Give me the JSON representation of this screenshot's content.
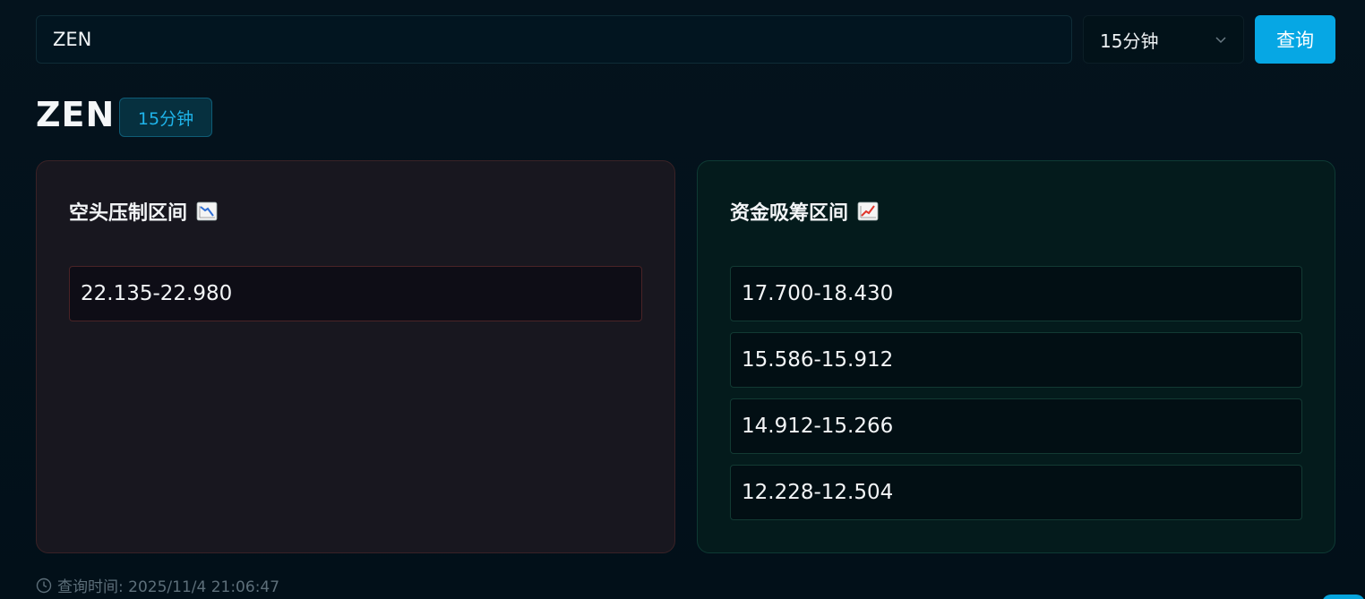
{
  "search": {
    "value": "ZEN"
  },
  "interval_select": {
    "selected": "15分钟",
    "icon": "chevron-down-icon"
  },
  "query_button": {
    "label": "查询"
  },
  "header": {
    "symbol": "ZEN",
    "interval_badge": "15分钟"
  },
  "bear_panel": {
    "title": "空头压制区间",
    "icon": "chart-decreasing-icon",
    "zones": [
      "22.135-22.980"
    ]
  },
  "bull_panel": {
    "title": "资金吸筹区间",
    "icon": "chart-increasing-icon",
    "zones": [
      "17.700-18.430",
      "15.586-15.912",
      "14.912-15.266",
      "12.228-12.504"
    ]
  },
  "footer": {
    "query_time": "查询时间: 2025/11/4 21:06:47",
    "icon": "clock-icon"
  },
  "colors": {
    "accent": "#06a7e4",
    "bear_border": "#4a2326",
    "bull_border": "#123a33"
  }
}
